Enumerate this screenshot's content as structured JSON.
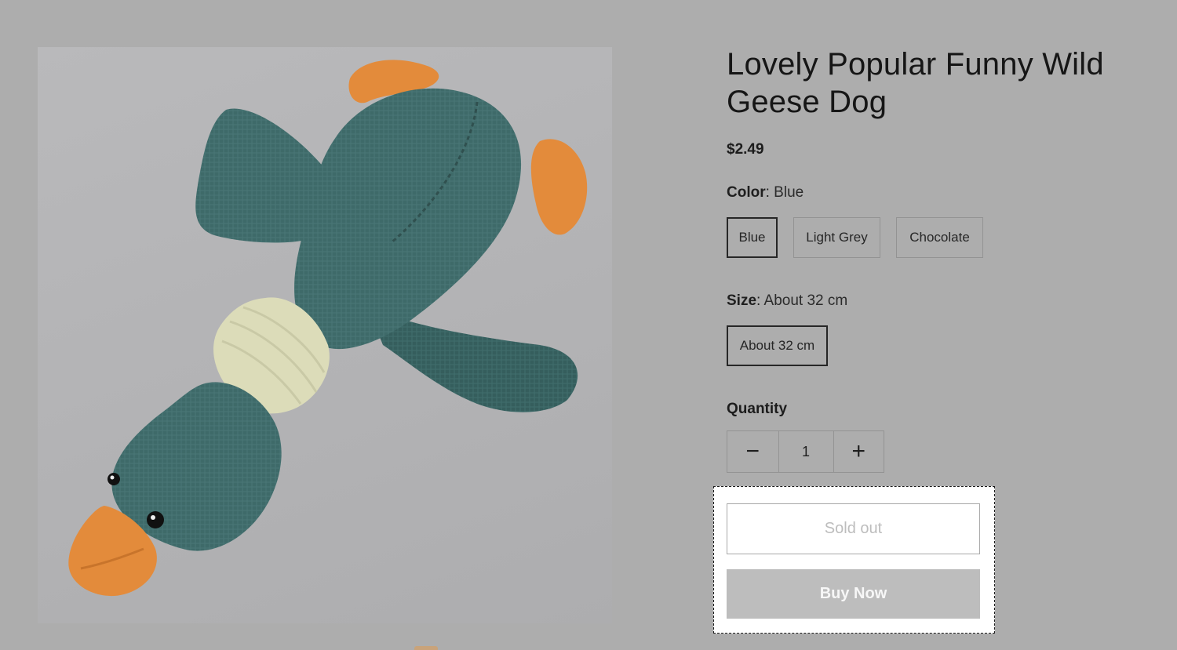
{
  "product": {
    "title": "Lovely Popular Funny Wild Geese Dog",
    "price": "$2.49",
    "image_icon": "plush-goose-toy-image"
  },
  "options": {
    "color": {
      "label": "Color",
      "separator": ":",
      "selected": "Blue",
      "values": [
        "Blue",
        "Light Grey",
        "Chocolate"
      ]
    },
    "size": {
      "label": "Size",
      "separator": ":",
      "selected": "About 32 cm",
      "values": [
        "About 32 cm"
      ]
    }
  },
  "quantity": {
    "label": "Quantity",
    "value": "1",
    "decrement_icon": "minus-icon",
    "increment_icon": "plus-icon",
    "decrement_glyph": "−",
    "increment_glyph": "+"
  },
  "actions": {
    "sold_out_label": "Sold out",
    "buy_now_label": "Buy Now"
  },
  "colors": {
    "page_overlay": "#adadad",
    "plush_teal": "#3f6b6a",
    "beak_orange": "#e08a3a",
    "neck_cream": "#dcdcb8",
    "buy_now_bg": "#bdbdbd"
  }
}
